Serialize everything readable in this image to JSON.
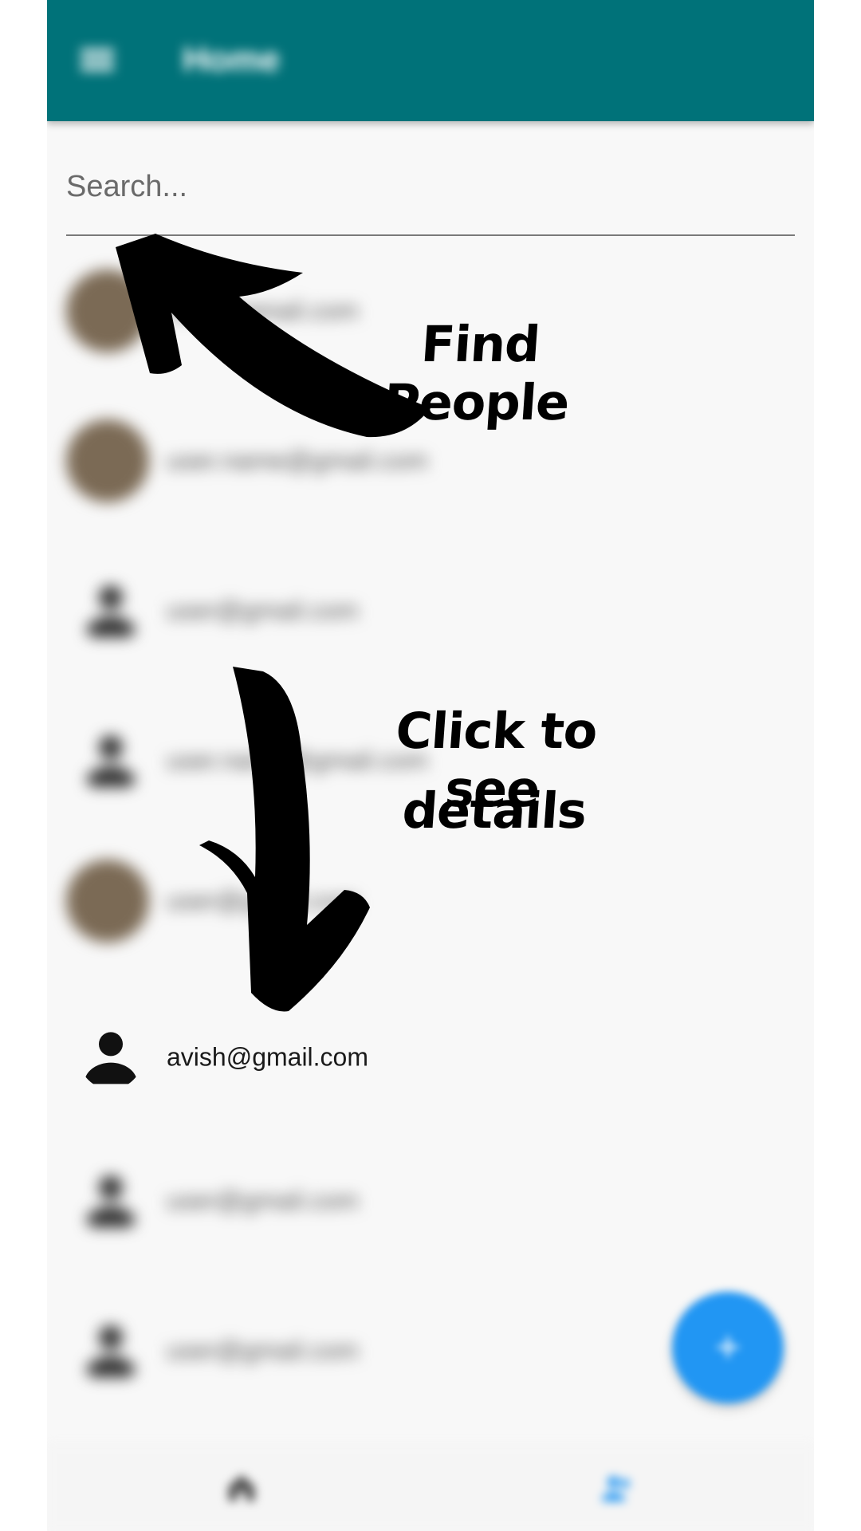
{
  "appbar": {
    "title": "Home"
  },
  "search": {
    "placeholder": "Search..."
  },
  "contacts": [
    {
      "email": "user@gmail.com",
      "avatar": "photo"
    },
    {
      "email": "user.name@gmail.com",
      "avatar": "photo"
    },
    {
      "email": "user@gmail.com",
      "avatar": "person-icon"
    },
    {
      "email": "user.name@gmail.com",
      "avatar": "person-icon"
    },
    {
      "email": "user@gmail.com",
      "avatar": "photo"
    },
    {
      "email": "avish@gmail.com",
      "avatar": "person-icon"
    },
    {
      "email": "user@gmail.com",
      "avatar": "person-icon"
    },
    {
      "email": "user@gmail.com",
      "avatar": "person-icon"
    }
  ],
  "annotations": {
    "find_people": "Find People",
    "click_details_line1": "Click to see",
    "click_details_line2": "details"
  },
  "fab": {
    "icon": "add-icon",
    "glyph": "+"
  },
  "bottom_nav": [
    {
      "icon": "home-icon"
    },
    {
      "icon": "people-icon"
    }
  ],
  "colors": {
    "appbar": "#007279",
    "fab": "#2196f3",
    "background": "#f8f8f8",
    "avatar_photo": "#7b6a55"
  }
}
